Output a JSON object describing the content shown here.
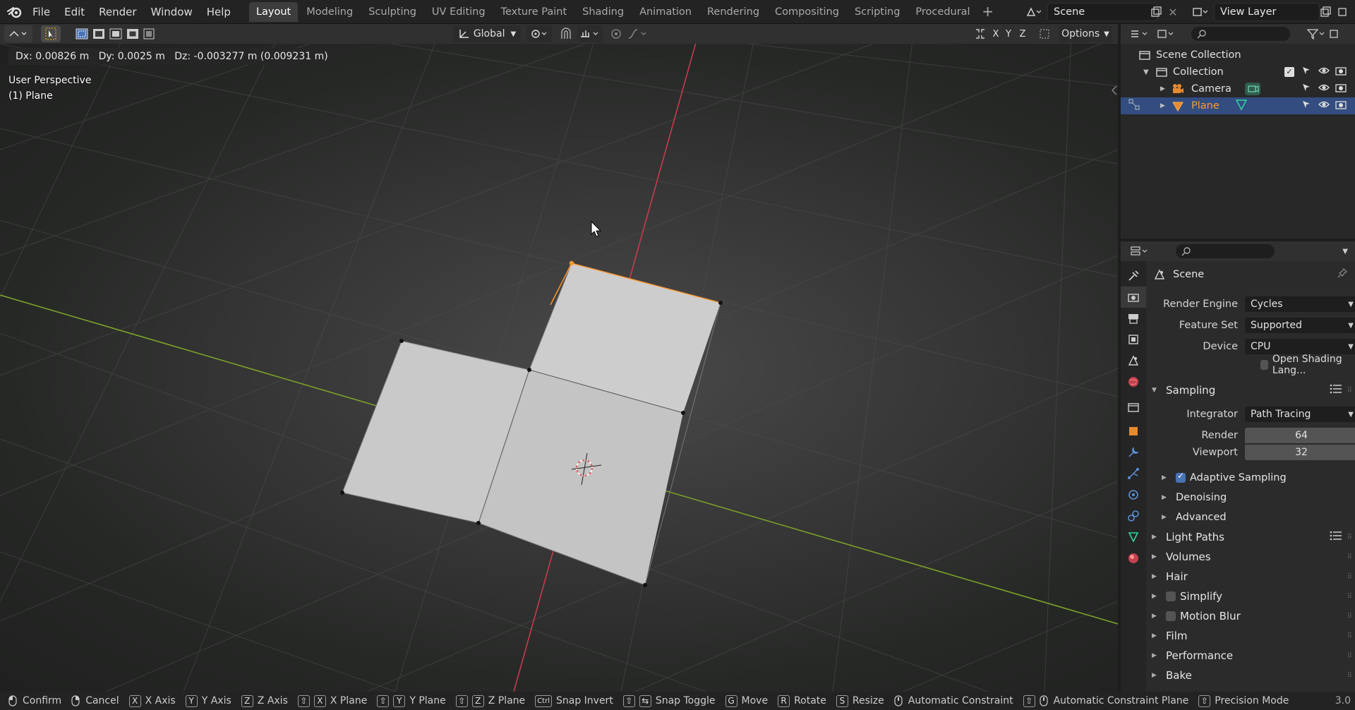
{
  "menu": {
    "file": "File",
    "edit": "Edit",
    "render": "Render",
    "window": "Window",
    "help": "Help"
  },
  "workspaces": [
    "Layout",
    "Modeling",
    "Sculpting",
    "UV Editing",
    "Texture Paint",
    "Shading",
    "Animation",
    "Rendering",
    "Compositing",
    "Scripting",
    "Procedural"
  ],
  "scene_name": "Scene",
  "view_layer": "View Layer",
  "header": {
    "orientation": "Global",
    "axes": [
      "X",
      "Y",
      "Z"
    ],
    "options": "Options"
  },
  "viewport": {
    "drag_info": "Dx: 0.00826 m   Dy: 0.0025 m   Dz: -0.003277 m (0.009231 m)",
    "perspective": "User Perspective",
    "object": "(1) Plane"
  },
  "outliner": {
    "scene_collection": "Scene Collection",
    "collection": "Collection",
    "camera": "Camera",
    "plane": "Plane"
  },
  "properties": {
    "context": "Scene",
    "render_engine_label": "Render Engine",
    "render_engine": "Cycles",
    "feature_set_label": "Feature Set",
    "feature_set": "Supported",
    "device_label": "Device",
    "device": "CPU",
    "osl": "Open Shading Lang...",
    "sampling": "Sampling",
    "integrator_label": "Integrator",
    "integrator": "Path Tracing",
    "render_label": "Render",
    "render_samples": "64",
    "viewport_label": "Viewport",
    "viewport_samples": "32",
    "adaptive": "Adaptive Sampling",
    "denoising": "Denoising",
    "advanced": "Advanced",
    "light_paths": "Light Paths",
    "volumes": "Volumes",
    "hair": "Hair",
    "simplify": "Simplify",
    "motion_blur": "Motion Blur",
    "film": "Film",
    "performance": "Performance",
    "bake": "Bake"
  },
  "status": {
    "confirm": "Confirm",
    "cancel": "Cancel",
    "x_axis": "X Axis",
    "y_axis": "Y Axis",
    "z_axis": "Z Axis",
    "x_plane": "X Plane",
    "y_plane": "Y Plane",
    "z_plane": "Z Plane",
    "snap_invert": "Snap Invert",
    "snap_toggle": "Snap Toggle",
    "move": "Move",
    "rotate": "Rotate",
    "resize": "Resize",
    "auto_constraint": "Automatic Constraint",
    "auto_constraint_plane": "Automatic Constraint Plane",
    "precision": "Precision Mode",
    "version": "3.0",
    "keys": {
      "x": "X",
      "y": "Y",
      "z": "Z",
      "ctrl": "Ctrl",
      "g": "G",
      "r": "R",
      "s": "S"
    }
  },
  "colors": {
    "accent": "#4772b3",
    "selection": "#334d80",
    "x_axis": "#c63b4f",
    "y_axis": "#7aa129",
    "edge_select": "#ff9a2e"
  }
}
